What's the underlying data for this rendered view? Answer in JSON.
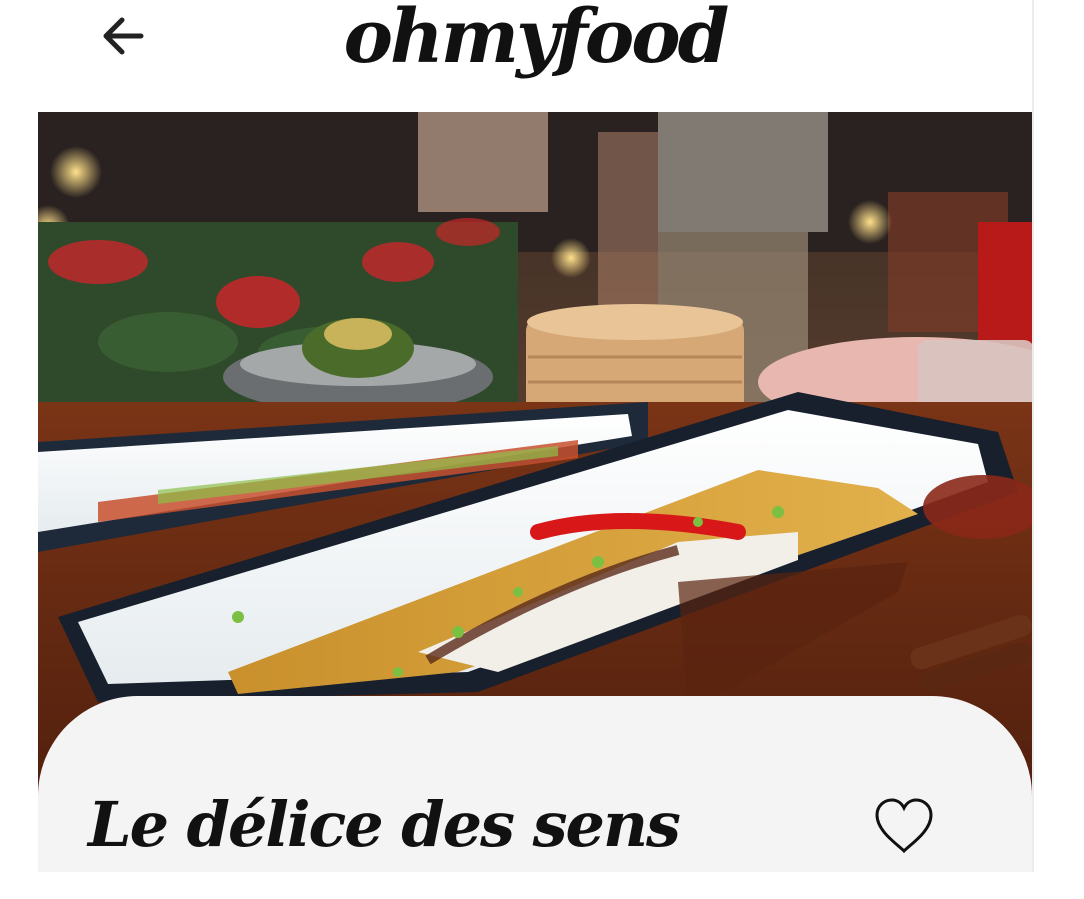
{
  "header": {
    "logo": "ohmyfood",
    "back_icon": "arrow-left-icon"
  },
  "hero": {
    "image_subject": "plated steamed fish on dark ceramic platters in a restaurant"
  },
  "restaurant": {
    "name": "Le délice des sens",
    "favorite_icon": "heart-outline-icon",
    "favorited": false
  },
  "colors": {
    "text": "#111111",
    "card_background": "#f4f4f4",
    "page_background": "#ffffff"
  }
}
